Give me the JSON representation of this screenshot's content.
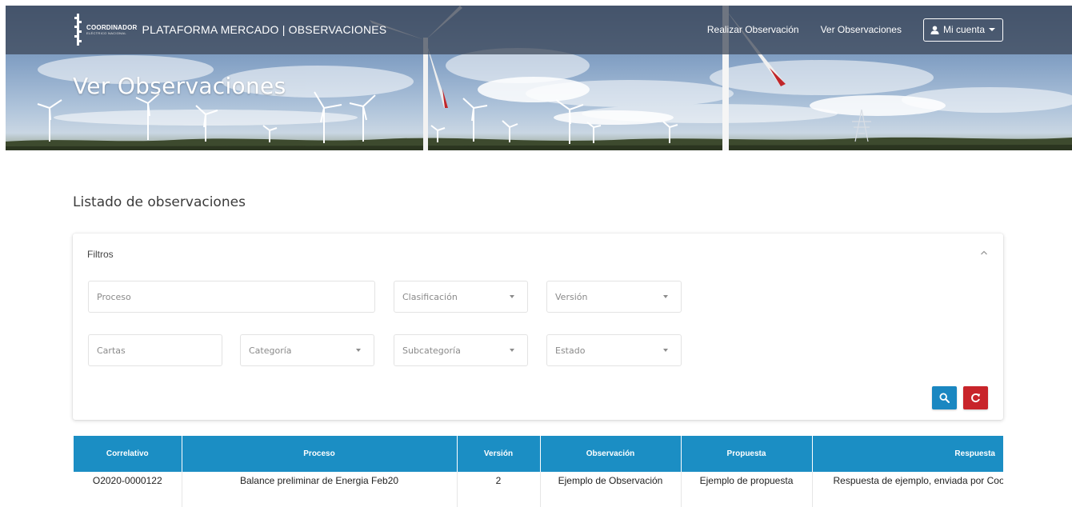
{
  "header": {
    "brand_small_1": "COORDINADOR",
    "brand_small_2": "ELÉCTRICO NACIONAL",
    "brand_title": "PLATAFORMA MERCADO | OBSERVACIONES",
    "nav": [
      "Realizar Observación",
      "Ver Observaciones"
    ],
    "account_label": "Mi cuenta",
    "icons": {
      "account": "user-icon",
      "account_caret": "caret-down-icon"
    }
  },
  "hero": {
    "title": "Ver Observaciones"
  },
  "main": {
    "section_title": "Listado de observaciones",
    "filters": {
      "label": "Filtros",
      "collapse_icon": "chevron-up-icon",
      "proceso_placeholder": "Proceso",
      "clasificacion": "Clasificación",
      "version": "Versión",
      "cartas_placeholder": "Cartas",
      "categoria": "Categoría",
      "subcategoria": "Subcategoría",
      "estado": "Estado",
      "search_icon": "search-icon",
      "reset_icon": "refresh-icon"
    },
    "table": {
      "columns": [
        "Correlativo",
        "Proceso",
        "Versión",
        "Observación",
        "Propuesta",
        "Respuesta"
      ],
      "rows": [
        [
          "O2020-0000122",
          "Balance preliminar de Energia Feb20",
          "2",
          "Ejemplo de Observación",
          "Ejemplo de propuesta",
          "Respuesta de ejemplo, enviada por Coord"
        ]
      ]
    }
  },
  "colors": {
    "header_bar": "#3a4454",
    "table_header": "#1b8ec4",
    "search_button": "#1a87c1",
    "reset_button": "#c8242a"
  }
}
